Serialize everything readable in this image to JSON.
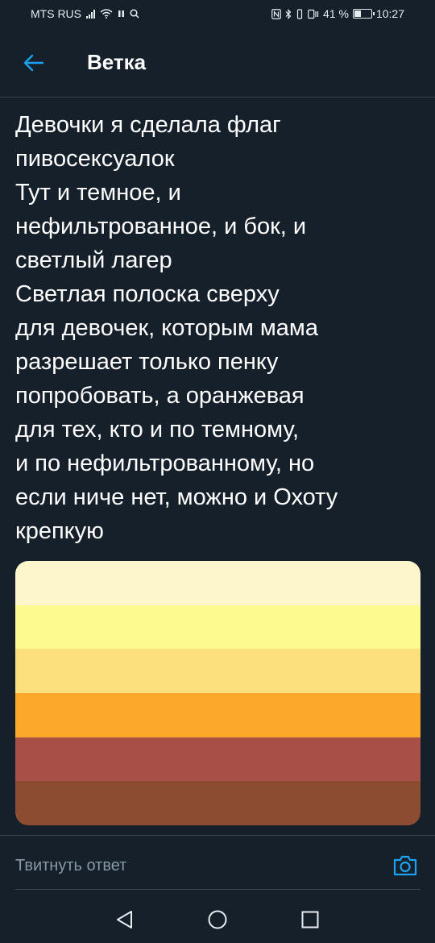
{
  "status_bar": {
    "carrier": "MTS RUS",
    "battery_text": "41 %",
    "time": "10:27",
    "battery_level": 0.41
  },
  "header": {
    "title": "Ветка"
  },
  "tweet": {
    "text": "Девочки я сделала флаг\nпивосексуалок\nТут и темное, и\nнефильтрованное, и бок, и\nсветлый лагер\nСветлая полоска сверху\nдля девочек, которым мама\nразрешает только пенку\nпопробовать, а оранжевая\nдля тех, кто и по темному,\nи по нефильтрованному, но\nесли ниче нет, можно и Охоту\nкрепкую"
  },
  "flag": {
    "stripes": [
      "#fdf6cc",
      "#fdfb8f",
      "#fbe07d",
      "#fca82a",
      "#a84f47",
      "#8b4c31"
    ]
  },
  "reply": {
    "placeholder": "Твитнуть ответ"
  },
  "colors": {
    "background": "#15202b",
    "accent": "#1da1f2",
    "divider": "#38444d",
    "muted_text": "#8899a6"
  },
  "icons": {
    "back": "arrow-left-icon",
    "camera": "camera-icon",
    "nav_back": "triangle-back-icon",
    "nav_home": "circle-home-icon",
    "nav_recents": "square-recents-icon"
  }
}
